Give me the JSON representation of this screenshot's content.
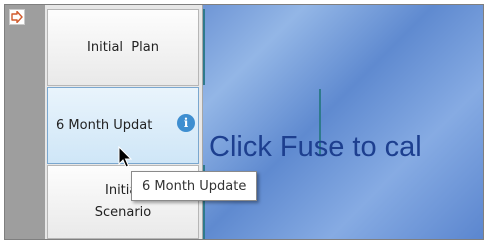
{
  "sidebar": {
    "collapse_icon": "arrow-right-icon",
    "buttons": [
      {
        "label": "Initial  Plan"
      },
      {
        "label": "6 Month Updat",
        "info_icon": "i"
      },
      {
        "label_line1": "Initial",
        "label_line2": "Scenario"
      }
    ]
  },
  "canvas": {
    "hint": "Click Fuse to cal"
  },
  "tooltip": {
    "text": "6 Month Update"
  },
  "colors": {
    "accent": "#3e8ed0",
    "canvas": "#6f96d6",
    "hint_text": "#1d3f8f"
  }
}
